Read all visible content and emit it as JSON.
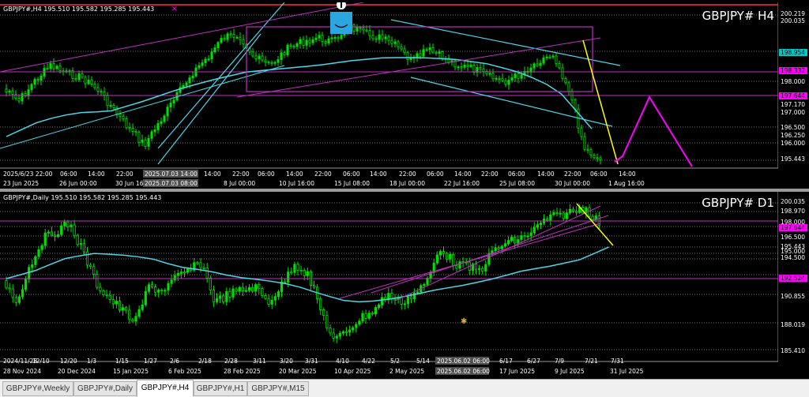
{
  "panels": [
    {
      "id": "h4",
      "header": "GBPJPY#,H4  195.510 195.582 195.285 195.443",
      "watermark": "GBPJPY#  H4",
      "price_labels": [
        {
          "text": "200.219",
          "bg": "#000000"
        },
        {
          "text": "200.035",
          "bg": "#000000"
        },
        {
          "text": "198.954",
          "bg": "#00c8c8"
        },
        {
          "text": "198.332",
          "bg": "#ff00ff"
        },
        {
          "text": "198.000",
          "bg": "#000000"
        },
        {
          "text": "197.644",
          "bg": "#ff00ff"
        },
        {
          "text": "197.170",
          "bg": "#000000"
        },
        {
          "text": "197.000",
          "bg": "#000000"
        },
        {
          "text": "196.500",
          "bg": "#000000"
        },
        {
          "text": "196.250",
          "bg": "#000000"
        },
        {
          "text": "196.000",
          "bg": "#000000"
        },
        {
          "text": "195.443",
          "bg": "#000000"
        }
      ],
      "time_labels": [
        "23 Jun 2025",
        "26 Jun 00:00",
        "30 Jun 16:00",
        "8 Jul 00:00",
        "10 Jul 16:00",
        "15 Jul 08:00",
        "18 Jul 00:00",
        "22 Jul 16:00",
        "25 Jul 08:00",
        "30 Jul 00:00",
        "1 Aug 16:00"
      ],
      "grid_labels": [
        "2025/6/23 22:00",
        "06:00",
        "14:00",
        "22:00",
        "06:00",
        "14:00",
        "22:00",
        "06:00",
        "14:00",
        "22:00",
        "06:00",
        "14:00",
        "22:00",
        "06:00",
        "14:00",
        "22:00",
        "06:00",
        "14:00",
        "22:00",
        "06:00",
        "14:00",
        "22:00"
      ],
      "crosshair_labels": [
        "2025.07.03 14:00",
        "2025.07.03 08:00"
      ]
    },
    {
      "id": "d1",
      "header": "GBPJPY#,Daily  195.510 195.582 195.285 195.443",
      "watermark": "GBPJPY#  D1",
      "price_labels": [
        {
          "text": "200.035",
          "bg": "#000000"
        },
        {
          "text": "198.970",
          "bg": "#000000"
        },
        {
          "text": "198.000",
          "bg": "#000000"
        },
        {
          "text": "197.644",
          "bg": "#ff00ff"
        },
        {
          "text": "196.500",
          "bg": "#000000"
        },
        {
          "text": "195.443",
          "bg": "#000000"
        },
        {
          "text": "195.000",
          "bg": "#000000"
        },
        {
          "text": "194.500",
          "bg": "#000000"
        },
        {
          "text": "192.524",
          "bg": "#ff00ff"
        },
        {
          "text": "190.855",
          "bg": "#000000"
        },
        {
          "text": "188.019",
          "bg": "#000000"
        },
        {
          "text": "185.410",
          "bg": "#000000"
        }
      ],
      "time_labels": [
        "28 Nov 2024",
        "20 Dec 2024",
        "15 Jan 2025",
        "6 Feb 2025",
        "28 Feb 2025",
        "20 Mar 2025",
        "10 Apr 2025",
        "2 May 2025",
        "17 Jun 2025",
        "9 Jul 2025",
        "31 Jul 2025"
      ],
      "grid_labels": [
        "2024/11/28",
        "12/10",
        "12/20",
        "1/3",
        "1/15",
        "1/27",
        "2/6",
        "2/18",
        "2/28",
        "3/11",
        "3/20",
        "3/31",
        "4/10",
        "4/22",
        "5/2",
        "5/14",
        "6/17",
        "6/27",
        "7/9",
        "7/21",
        "7/31"
      ],
      "crosshair_labels": [
        "2025.06.02 06:00",
        "2025.06.02 06:00"
      ]
    }
  ],
  "tabs": [
    {
      "label": "GBPJPY#,Weekly",
      "active": false
    },
    {
      "label": "GBPJPY#,Daily",
      "active": false
    },
    {
      "label": "GBPJPY#,H4",
      "active": true
    },
    {
      "label": "GBPJPY#,H1",
      "active": false
    },
    {
      "label": "GBPJPY#,M15",
      "active": false
    }
  ],
  "colors": {
    "candle": "#00ff00",
    "ma": "#4ad8e8",
    "channel": "#c830c8",
    "forecast": "#ff00ff",
    "trend": "#ffff00"
  }
}
